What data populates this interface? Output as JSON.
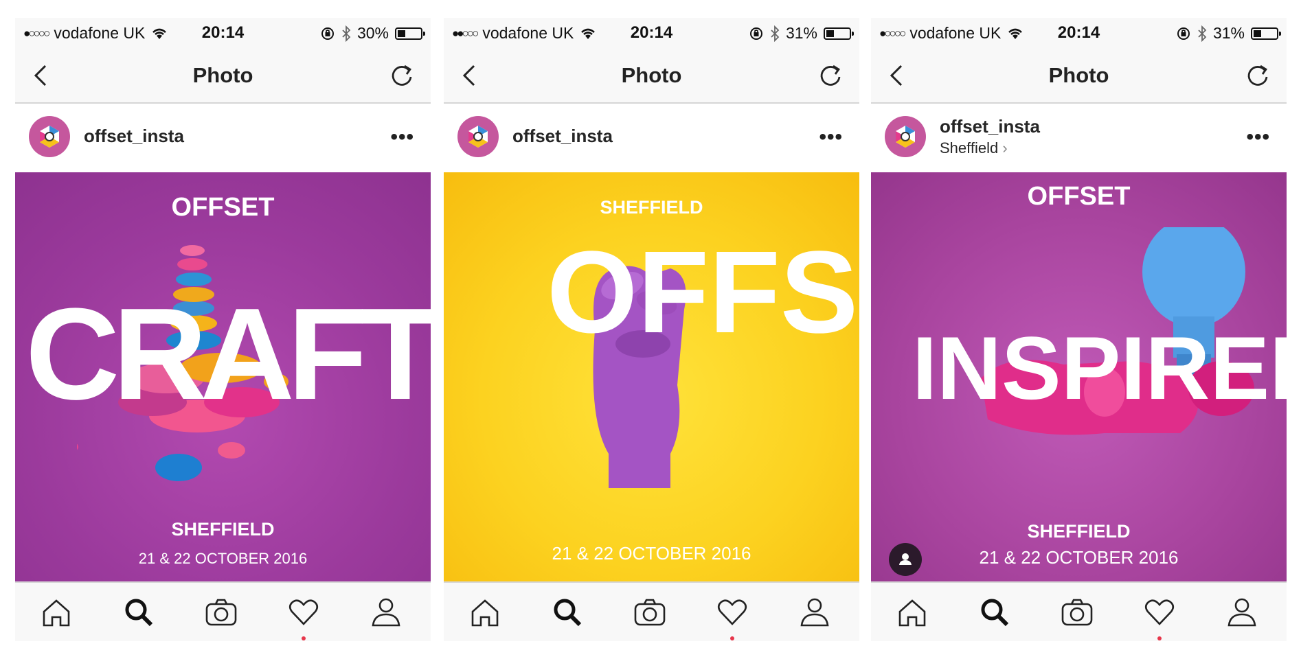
{
  "colors": {
    "purple_bg": "#9b3a9c",
    "yellow_bg": "#fcd220",
    "notification_dot": "#e7364b"
  },
  "screens": [
    {
      "status": {
        "carrier": "vodafone UK",
        "signal": "●○○○○",
        "time": "20:14",
        "battery": "30%",
        "battery_level": 0.3
      },
      "nav": {
        "title": "Photo"
      },
      "post": {
        "username": "offset_insta",
        "location": "",
        "more": "•••"
      },
      "poster": {
        "top": "OFFSET",
        "word": "CRAFTY",
        "bottom": "SHEFFIELD",
        "date": "21 & 22 OCTOBER 2016"
      }
    },
    {
      "status": {
        "carrier": "vodafone UK",
        "signal": "●●○○○",
        "time": "20:14",
        "battery": "31%",
        "battery_level": 0.31
      },
      "nav": {
        "title": "Photo"
      },
      "post": {
        "username": "offset_insta",
        "location": "",
        "more": "•••"
      },
      "poster": {
        "top": "SHEFFIELD",
        "word": "OFFSET",
        "bottom": "",
        "date": "21 & 22 OCTOBER 2016"
      }
    },
    {
      "status": {
        "carrier": "vodafone UK",
        "signal": "●○○○○",
        "time": "20:14",
        "battery": "31%",
        "battery_level": 0.31
      },
      "nav": {
        "title": "Photo"
      },
      "post": {
        "username": "offset_insta",
        "location": "Sheffield",
        "more": "•••"
      },
      "poster": {
        "top": "OFFSET",
        "word": "INSPIRED",
        "bottom": "SHEFFIELD",
        "date": "21 & 22 OCTOBER 2016"
      }
    }
  ],
  "tabs": [
    "home-icon",
    "search-icon",
    "camera-icon",
    "heart-icon",
    "profile-icon"
  ]
}
